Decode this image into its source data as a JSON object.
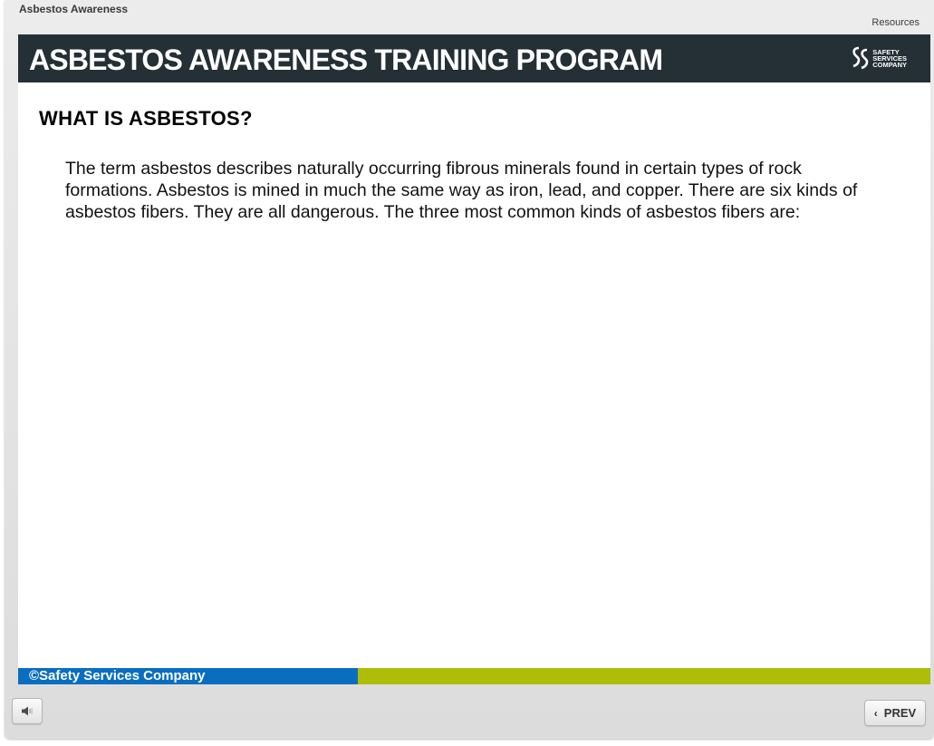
{
  "app": {
    "title": "Asbestos Awareness",
    "resources_label": "Resources"
  },
  "slide": {
    "banner_title": "ASBESTOS AWARENESS TRAINING PROGRAM",
    "logo": {
      "line1": "SAFETY",
      "line2": "SERVICES",
      "line3": "COMPANY"
    },
    "heading": "WHAT IS ASBESTOS?",
    "body": "The term asbestos describes naturally occurring fibrous minerals found in certain types of rock formations.  Asbestos is mined in much the same way as iron, lead, and copper.  There are six kinds of asbestos fibers. They are all dangerous. The three most common kinds of asbestos fibers are:",
    "footer_copyright": "©Safety Services Company"
  },
  "controls": {
    "audio_icon": "speaker-icon",
    "prev_label": "PREV",
    "prev_icon": "chevron-left-icon"
  },
  "colors": {
    "banner": "#243036",
    "footer_blue": "#0a6ec0",
    "footer_green": "#aebc0a"
  }
}
